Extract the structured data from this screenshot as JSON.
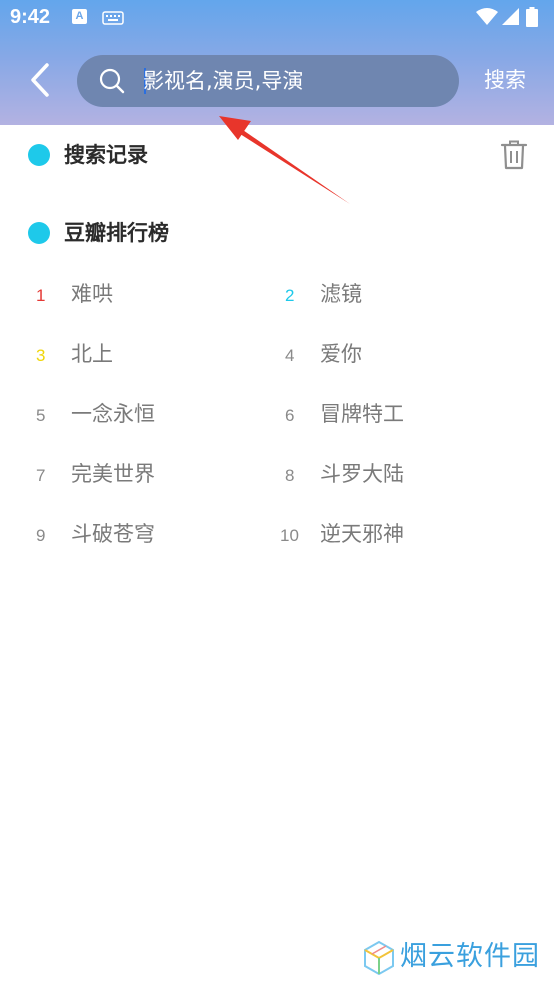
{
  "status_bar": {
    "time": "9:42",
    "notif_letter": "A",
    "icons": [
      "keyboard-icon",
      "wifi-icon",
      "signal-icon",
      "battery-icon"
    ]
  },
  "header": {
    "back_icon": "chevron-left-icon",
    "search_placeholder": "影视名,演员,导演",
    "search_label": "搜索"
  },
  "history": {
    "title": "搜索记录",
    "clear_icon": "trash-icon"
  },
  "ranking": {
    "title": "豆瓣排行榜",
    "items": [
      {
        "rank": "1",
        "name": "难哄"
      },
      {
        "rank": "2",
        "name": "滤镜"
      },
      {
        "rank": "3",
        "name": "北上"
      },
      {
        "rank": "4",
        "name": "爱你"
      },
      {
        "rank": "5",
        "name": "一念永恒"
      },
      {
        "rank": "6",
        "name": "冒牌特工"
      },
      {
        "rank": "7",
        "name": "完美世界"
      },
      {
        "rank": "8",
        "name": "斗罗大陆"
      },
      {
        "rank": "9",
        "name": "斗破苍穹"
      },
      {
        "rank": "10",
        "name": "逆天邪神"
      }
    ]
  },
  "watermark": {
    "text": "烟云软件园"
  },
  "colors": {
    "accent": "#1ec9ea",
    "rank1": "#e53935",
    "rank2": "#1ec9ea",
    "rank3": "#f0d60a",
    "rank_default": "#8a8a8a",
    "annotation_arrow": "#e8352b",
    "watermark": "#3aa0de"
  }
}
